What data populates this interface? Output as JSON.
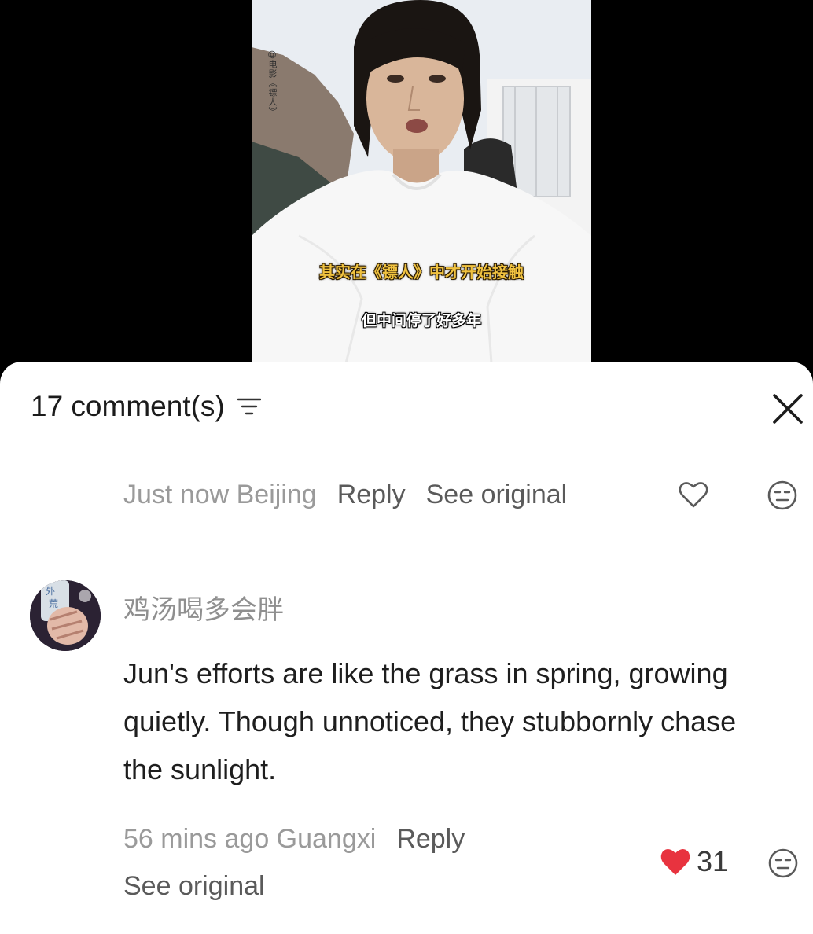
{
  "video": {
    "watermark": "@电影《镖人》",
    "subtitle_1": "其实在《镖人》中才开始接触",
    "subtitle_2": "但中间停了好多年"
  },
  "sheet": {
    "comment_count": "17 comment(s)",
    "filter_icon": "filter-icon",
    "close_icon": "close-icon"
  },
  "comments": [
    {
      "time_location": "Just now Beijing",
      "reply_label": "Reply",
      "see_original_label": "See original",
      "like_icon": "heart-outline-icon",
      "dislike_icon": "neutral-face-icon"
    },
    {
      "username": "鸡汤喝多会胖",
      "text": "Jun's efforts are like the grass in spring, growing quietly. Though unnoticed, they stubbornly chase the sunlight.",
      "time_location": "56 mins ago Guangxi",
      "reply_label": "Reply",
      "see_original_label": "See original",
      "like_count": "31",
      "like_icon": "heart-filled-icon",
      "dislike_icon": "neutral-face-icon",
      "like_color": "#e8333f"
    }
  ]
}
